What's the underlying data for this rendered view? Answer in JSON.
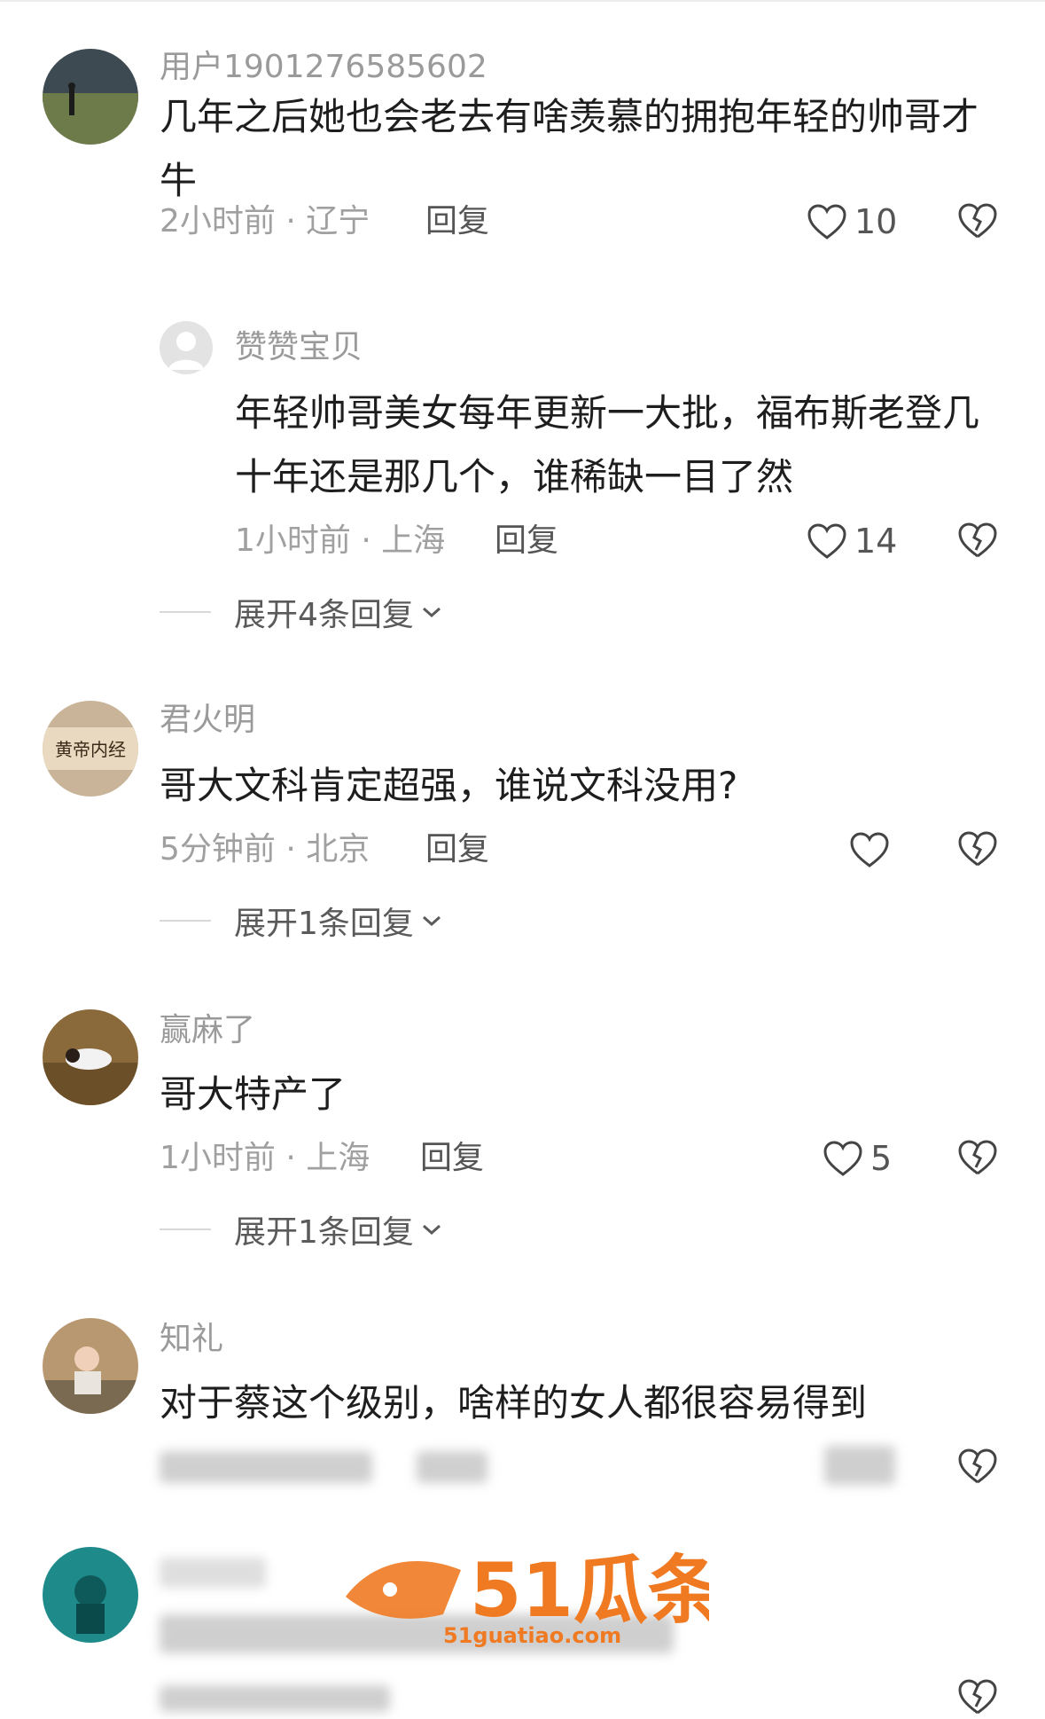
{
  "comments": [
    {
      "username": "用户1901276585602",
      "text": "几年之后她也会老去有啥羡慕的拥抱年轻的帅哥才牛",
      "meta": "2小时前 · 辽宁",
      "reply_label": "回复",
      "likes": "10",
      "avatar_icon": "person-in-field-avatar",
      "sub_reply": {
        "username": "赞赞宝贝",
        "text": "年轻帅哥美女每年更新一大批，福布斯老登几十年还是那几个，谁稀缺一目了然",
        "meta": "1小时前 · 上海",
        "reply_label": "回复",
        "likes": "14"
      },
      "expand_label": "展开4条回复"
    },
    {
      "username": "君火明",
      "text": "哥大文科肯定超强，谁说文科没用?",
      "meta": "5分钟前 · 北京",
      "reply_label": "回复",
      "likes": "",
      "avatar_text": "黄帝内经",
      "expand_label": "展开1条回复"
    },
    {
      "username": "赢麻了",
      "text": "哥大特产了",
      "meta": "1小时前 · 上海",
      "reply_label": "回复",
      "likes": "5",
      "avatar_icon": "person-lying-on-grass-avatar",
      "expand_label": "展开1条回复"
    },
    {
      "username": "知礼",
      "text": "对于蔡这个级别，啥样的女人都很容易得到",
      "avatar_icon": "child-photo-avatar"
    },
    {
      "avatar_icon": "diver-underwater-avatar"
    }
  ],
  "watermark": {
    "brand": "51瓜条",
    "url": "51guatiao.com",
    "color": "#f07a22"
  },
  "colors": {
    "username": "#9a9a9a",
    "text": "#1e1e1e",
    "meta": "#a0a0a0"
  }
}
